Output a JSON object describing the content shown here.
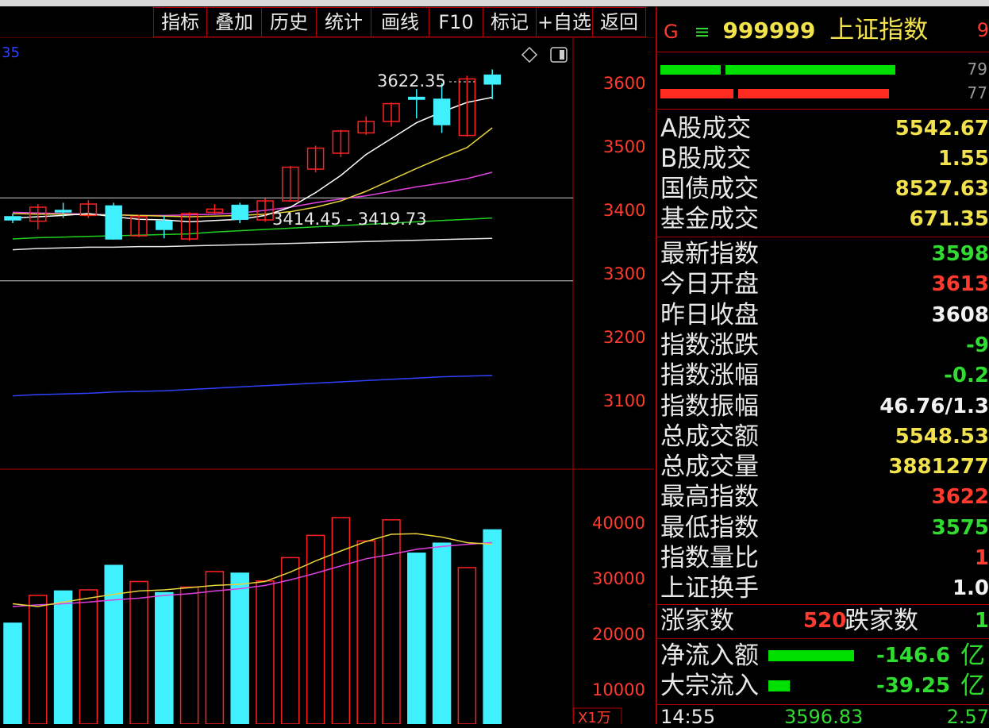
{
  "toolbar": {
    "buttons": [
      "指标",
      "叠加",
      "历史",
      "统计",
      "画线",
      "F10",
      "标记",
      "+自选",
      "返回"
    ]
  },
  "chart": {
    "corner_label": "35",
    "price_axis": [
      "3600",
      "3500",
      "3400",
      "3300",
      "3200",
      "3100"
    ],
    "volume_axis": [
      "40000",
      "30000",
      "20000",
      "10000"
    ],
    "volume_unit": "X1万",
    "high_label": "3622.35",
    "range_label": "3414.45 - 3419.73",
    "colors": {
      "up": "#ff2020",
      "down": "#40f0ff",
      "ma5": "#ffffff",
      "ma10": "#e6d23a",
      "ma20": "#e040e0",
      "ma60": "#20d020",
      "ma120": "#e8e8e8",
      "ma250": "#3040ff"
    }
  },
  "chart_data": {
    "type": "candlestick",
    "candles": [
      {
        "o": 3390,
        "c": 3385,
        "h": 3395,
        "l": 3380
      },
      {
        "o": 3383,
        "c": 3405,
        "h": 3410,
        "l": 3370
      },
      {
        "o": 3400,
        "c": 3398,
        "h": 3412,
        "l": 3388
      },
      {
        "o": 3392,
        "c": 3410,
        "h": 3416,
        "l": 3388
      },
      {
        "o": 3407,
        "c": 3355,
        "h": 3412,
        "l": 3354
      },
      {
        "o": 3360,
        "c": 3390,
        "h": 3393,
        "l": 3358
      },
      {
        "o": 3383,
        "c": 3370,
        "h": 3392,
        "l": 3356
      },
      {
        "o": 3355,
        "c": 3395,
        "h": 3397,
        "l": 3352
      },
      {
        "o": 3397,
        "c": 3402,
        "h": 3410,
        "l": 3395
      },
      {
        "o": 3408,
        "c": 3386,
        "h": 3412,
        "l": 3380
      },
      {
        "o": 3385,
        "c": 3415,
        "h": 3419,
        "l": 3382
      },
      {
        "o": 3415,
        "c": 3468,
        "h": 3470,
        "l": 3414
      },
      {
        "o": 3465,
        "c": 3498,
        "h": 3502,
        "l": 3460
      },
      {
        "o": 3490,
        "c": 3525,
        "h": 3527,
        "l": 3484
      },
      {
        "o": 3522,
        "c": 3540,
        "h": 3548,
        "l": 3519
      },
      {
        "o": 3540,
        "c": 3568,
        "h": 3570,
        "l": 3532
      },
      {
        "o": 3578,
        "c": 3575,
        "h": 3591,
        "l": 3545
      },
      {
        "o": 3575,
        "c": 3535,
        "h": 3600,
        "l": 3522
      },
      {
        "o": 3518,
        "c": 3607,
        "h": 3612,
        "l": 3516
      },
      {
        "o": 3613,
        "c": 3599,
        "h": 3622,
        "l": 3575
      }
    ],
    "ma5": [
      3388,
      3390,
      3392,
      3395,
      3390,
      3386,
      3385,
      3382,
      3384,
      3386,
      3392,
      3405,
      3428,
      3455,
      3488,
      3513,
      3538,
      3555,
      3570,
      3578
    ],
    "ma10": [
      3395,
      3394,
      3394,
      3393,
      3393,
      3392,
      3391,
      3390,
      3391,
      3392,
      3394,
      3398,
      3405,
      3415,
      3430,
      3448,
      3466,
      3483,
      3499,
      3530
    ],
    "ma20": [
      3397,
      3396,
      3395,
      3394,
      3393,
      3392,
      3392,
      3393,
      3394,
      3396,
      3400,
      3405,
      3412,
      3418,
      3423,
      3430,
      3437,
      3443,
      3450,
      3460
    ],
    "ma60": [
      3355,
      3357,
      3358,
      3359,
      3360,
      3361,
      3362,
      3363,
      3366,
      3368,
      3370,
      3372,
      3374,
      3376,
      3378,
      3380,
      3382,
      3384,
      3386,
      3388
    ],
    "ma120": [
      3338,
      3340,
      3341,
      3342,
      3342,
      3343,
      3343,
      3344,
      3345,
      3346,
      3347,
      3348,
      3349,
      3350,
      3351,
      3352,
      3353,
      3354,
      3355,
      3356
    ],
    "ma250": [
      3108,
      3110,
      3111,
      3112,
      3114,
      3115,
      3116,
      3118,
      3120,
      3122,
      3124,
      3126,
      3128,
      3130,
      3132,
      3134,
      3136,
      3138,
      3139,
      3140
    ],
    "volume": [
      22000,
      27000,
      27800,
      28000,
      32400,
      29500,
      27500,
      28500,
      31300,
      31000,
      29600,
      33800,
      37800,
      41000,
      36800,
      40600,
      34600,
      36400,
      32000,
      38800
    ],
    "vol_ma5": [
      25500,
      25000,
      25800,
      26500,
      27200,
      27800,
      28000,
      28400,
      28800,
      29000,
      29500,
      31200,
      33200,
      35000,
      36700,
      38000,
      38100,
      37500,
      36500,
      36200
    ],
    "vol_ma10": [
      25000,
      25300,
      25500,
      25800,
      26200,
      26500,
      27000,
      27300,
      27800,
      28200,
      28800,
      29800,
      31000,
      32300,
      33600,
      34400,
      35300,
      35800,
      36200,
      36500
    ],
    "ylim_price": [
      3050,
      3660
    ],
    "ylim_volume": [
      0,
      44000
    ]
  },
  "quote": {
    "prefix": "G",
    "menu_icon": "≡",
    "code": "999999",
    "name": "上证指数",
    "cut_right": "9",
    "bar_vals": [
      "79",
      "77"
    ],
    "rows1": [
      {
        "label": "A股成交",
        "value": "5542.67"
      },
      {
        "label": "B股成交",
        "value": "1.55"
      },
      {
        "label": "国债成交",
        "value": "8527.63"
      },
      {
        "label": "基金成交",
        "value": "671.35"
      }
    ],
    "rows2": [
      {
        "label": "最新指数",
        "value": "3598",
        "color": "gr"
      },
      {
        "label": "今日开盘",
        "value": "3613",
        "color": "r"
      },
      {
        "label": "昨日收盘",
        "value": "3608",
        "color": "w"
      },
      {
        "label": "指数涨跌",
        "value": "-9",
        "color": "gr"
      },
      {
        "label": "指数涨幅",
        "value": "-0.2",
        "color": "gr"
      },
      {
        "label": "指数振幅",
        "value": "46.76/1.3",
        "color": "w"
      },
      {
        "label": "总成交额",
        "value": "5548.53",
        "color": "y"
      },
      {
        "label": "总成交量",
        "value": "3881277",
        "color": "y"
      },
      {
        "label": "最高指数",
        "value": "3622",
        "color": "r"
      },
      {
        "label": "最低指数",
        "value": "3575",
        "color": "gr"
      },
      {
        "label": "指数量比",
        "value": "1",
        "color": "r"
      },
      {
        "label": "上证换手",
        "value": "1.0",
        "color": "w"
      }
    ],
    "up_label": "涨家数",
    "up_value": "520",
    "down_label": "跌家数",
    "down_value": "1",
    "flow": [
      {
        "label": "净流入额",
        "value": "-146.6",
        "unit": "亿",
        "bar": 0.36
      },
      {
        "label": "大宗流入",
        "value": "-39.25",
        "unit": "亿",
        "bar": 0.09
      }
    ],
    "time": "14:55",
    "tick_price": "3596.83",
    "tick_vol": "2.57"
  }
}
